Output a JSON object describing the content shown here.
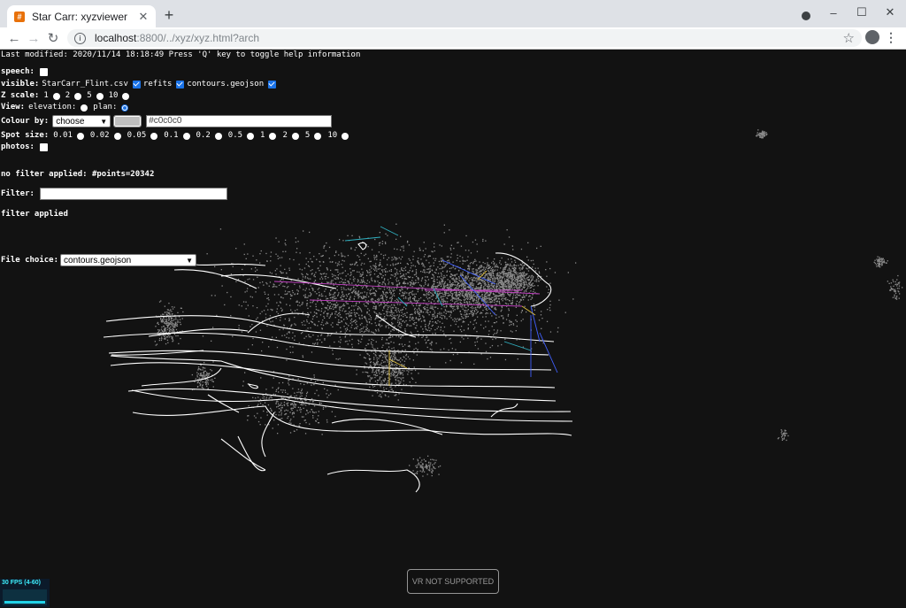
{
  "browser": {
    "tab_title": "Star Carr: xyzviewer",
    "url_host": "localhost",
    "url_rest": ":8800/../xyz/xyz.html?arch",
    "new_tab_label": "+",
    "window_controls": {
      "minimize": "–",
      "maximize": "☐",
      "close": "✕"
    }
  },
  "header": {
    "last_modified": "Last modified: 2020/11/14 18:18:49 Press 'Q' key to toggle help information"
  },
  "controls": {
    "speech_label": "speech:",
    "visible_label": "visible:",
    "visible_items": [
      {
        "label": "StarCarr_Flint.csv",
        "checked": true
      },
      {
        "label": "refits",
        "checked": true
      },
      {
        "label": "contours.geojson",
        "checked": true
      }
    ],
    "zscale_label": "Z scale:",
    "zscale_options": [
      "1",
      "2",
      "5",
      "10"
    ],
    "view_label": "View:",
    "view_options": [
      {
        "label": "elevation:",
        "selected": false
      },
      {
        "label": "plan:",
        "selected": true
      }
    ],
    "colour_label": "Colour by:",
    "colour_select_value": "choose",
    "colour_hex_value": "#c0c0c0",
    "spot_label": "Spot size:",
    "spot_options": [
      "0.01",
      "0.02",
      "0.05",
      "0.1",
      "0.2",
      "0.5",
      "1",
      "2",
      "5",
      "10"
    ],
    "photos_label": "photos:",
    "filter_status": "no filter applied: #points=20342",
    "filter_label": "Filter:",
    "filter_value": "",
    "filter_applied": "filter applied",
    "file_choice_label": "File choice:",
    "file_choice_value": "contours.geojson"
  },
  "stats": {
    "fps_text": "30 FPS (4-60)"
  },
  "vr_button": {
    "label": "VR NOT SUPPORTED"
  },
  "scene_colors": {
    "background": "#121212",
    "points": "#8a8a8a",
    "contours": "#ffffff",
    "refits_magenta": "#c040c0",
    "refits_blue": "#4060ff",
    "refits_cyan": "#30b0c0",
    "refits_yellow": "#e0c040"
  }
}
